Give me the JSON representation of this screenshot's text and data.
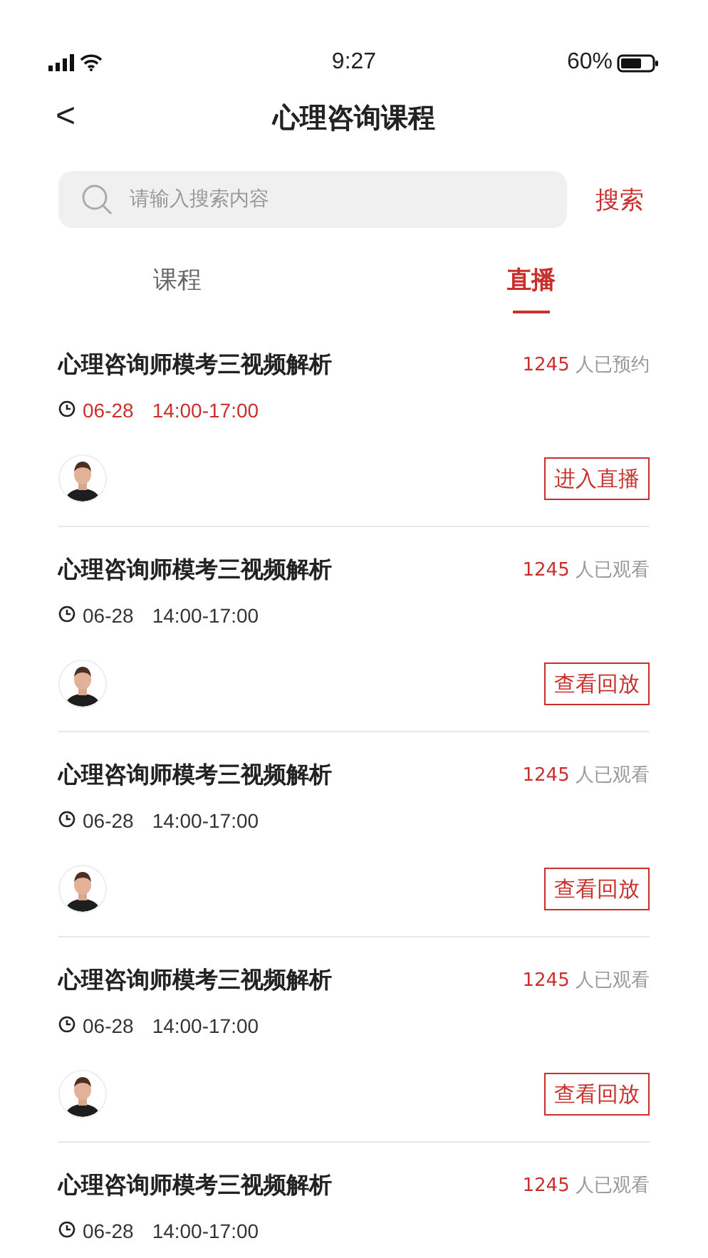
{
  "status_bar": {
    "time": "9:27",
    "battery": "60%"
  },
  "nav": {
    "back": "<",
    "title": "心理咨询课程"
  },
  "search": {
    "placeholder": "请输入搜索内容",
    "button": "搜索"
  },
  "tabs": [
    {
      "label": "课程",
      "selected": false
    },
    {
      "label": "直播",
      "selected": true
    }
  ],
  "items": [
    {
      "title": "心理咨询师模考三视频解析",
      "count": "1245",
      "count_suffix": "人已预约",
      "date": "06-28",
      "time": "14:00-17:00",
      "live": true,
      "button": "进入直播"
    },
    {
      "title": "心理咨询师模考三视频解析",
      "count": "1245",
      "count_suffix": "人已观看",
      "date": "06-28",
      "time": "14:00-17:00",
      "live": false,
      "button": "查看回放"
    },
    {
      "title": "心理咨询师模考三视频解析",
      "count": "1245",
      "count_suffix": "人已观看",
      "date": "06-28",
      "time": "14:00-17:00",
      "live": false,
      "button": "查看回放"
    },
    {
      "title": "心理咨询师模考三视频解析",
      "count": "1245",
      "count_suffix": "人已观看",
      "date": "06-28",
      "time": "14:00-17:00",
      "live": false,
      "button": "查看回放"
    },
    {
      "title": "心理咨询师模考三视频解析",
      "count": "1245",
      "count_suffix": "人已观看",
      "date": "06-28",
      "time": "14:00-17:00",
      "live": false
    }
  ]
}
